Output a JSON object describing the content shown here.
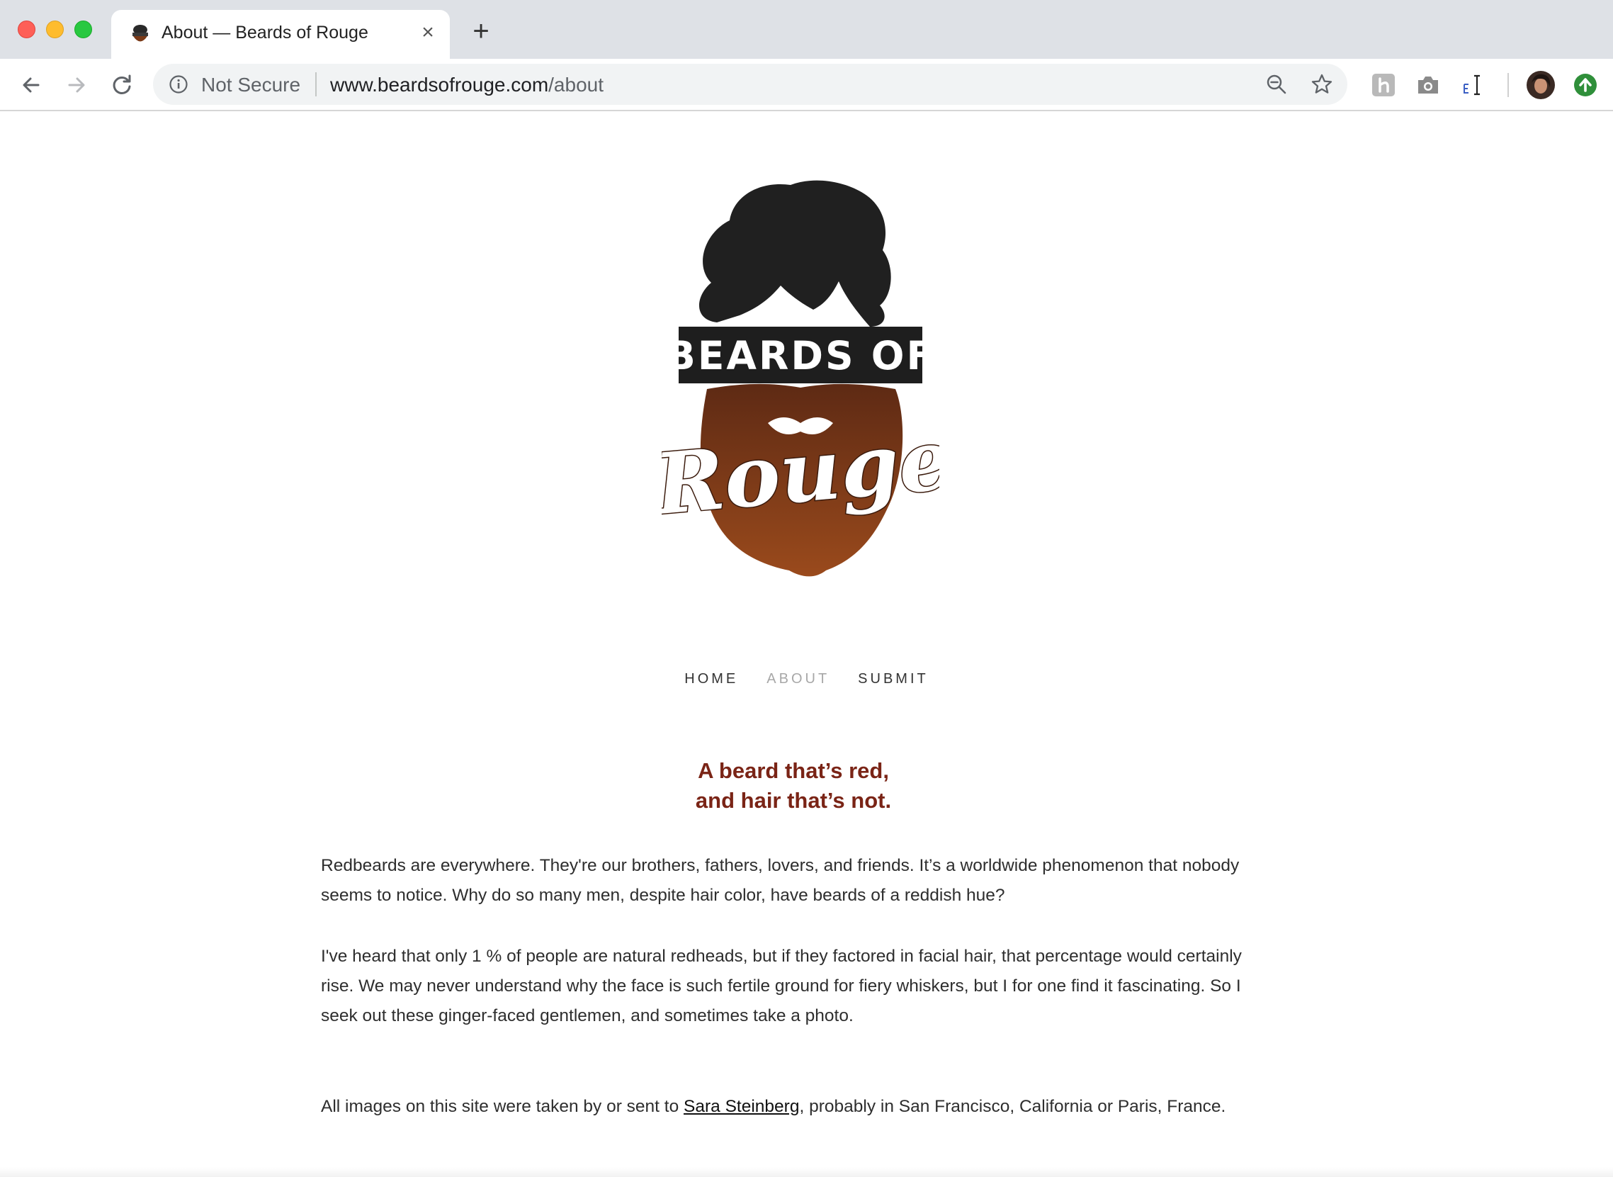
{
  "browser": {
    "tab_title": "About — Beards of Rouge",
    "close_glyph": "×",
    "new_tab_glyph": "+",
    "security_label": "Not Secure",
    "url_host": "www.beardsofrouge.com",
    "url_path": "/about",
    "icons": [
      "back-icon",
      "forward-icon",
      "reload-icon",
      "info-icon",
      "zoom-out-icon",
      "bookmark-star-icon",
      "extension-icon",
      "camera-icon",
      "text-cursor-icon",
      "profile-avatar",
      "update-icon"
    ]
  },
  "logo": {
    "line1": "BEARDS OF",
    "line2": "Rouge"
  },
  "nav": {
    "items": [
      {
        "label": "HOME",
        "active": false
      },
      {
        "label": "ABOUT",
        "active": true
      },
      {
        "label": "SUBMIT",
        "active": false
      }
    ]
  },
  "content": {
    "headline_line1": "A beard that’s red,",
    "headline_line2": "and hair that’s not.",
    "paragraph1": "Redbeards are everywhere. They're our brothers, fathers, lovers, and friends. It’s a worldwide phenomenon that nobody seems to notice. Why do so many men, despite hair color, have beards of a reddish hue?",
    "paragraph2": "I've heard that only 1 % of people are natural redheads, but if they factored in facial hair, that percentage would certainly rise. We may never understand why the face is such fertile ground for fiery whiskers, but I for one find it fascinating. So I seek out these ginger-faced gentlemen, and sometimes take a photo.",
    "credit_prefix": "All images on this site were taken by or sent to ",
    "credit_link": "Sara Steinberg",
    "credit_suffix": ", probably in San Francisco, California or Paris, France."
  },
  "colors": {
    "headline": "#7a2416",
    "nav_active": "#a8a8a8",
    "beard_top": "#5e2a14",
    "beard_bottom": "#9a4a1c"
  }
}
